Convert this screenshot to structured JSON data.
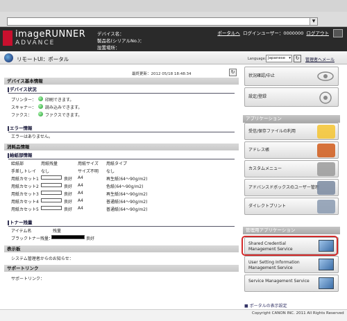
{
  "chrome": {},
  "header": {
    "logo_line1": "imageRUNNER",
    "logo_line2": "ADVANCE",
    "device_name": "デバイス名：",
    "serial": "製品名(シリアルNo.)：",
    "location": "設置場所：",
    "portal_link": "ポータルへ",
    "login_user": "ログインユーザー：0000000",
    "logout": "ログアウト"
  },
  "nav": {
    "title": "リモートUI：ポータル",
    "language_label": "Language:",
    "language_value": "Japanese",
    "manager_link": "管理者へメール"
  },
  "main": {
    "last_updated": "最終更新：2012 05/18 18:48:34",
    "device_info_header": "デバイス基本情報",
    "device_status_title": "デバイス状況",
    "device_status": [
      {
        "label": "プリンター：",
        "value": "印刷できます。"
      },
      {
        "label": "スキャナー：",
        "value": "読み込みできます。"
      },
      {
        "label": "ファクス：",
        "value": "ファクスできます。"
      }
    ],
    "error_title": "エラー情報",
    "error_text": "エラーはありません。",
    "consumables_header": "消耗品情報",
    "paper_title": "給紙部情報",
    "paper_columns": [
      "給紙部",
      "用紙残量",
      "用紙サイズ",
      "用紙タイプ"
    ],
    "paper_rows": [
      {
        "source": "手差しトレイ",
        "level": "なし",
        "size": "サイズ不明",
        "type": "なし",
        "bar": false
      },
      {
        "source": "用紙カセット1",
        "level": "良好",
        "size": "A4",
        "type": "再生紙(64〜90g/m2)",
        "bar": true
      },
      {
        "source": "用紙カセット2",
        "level": "良好",
        "size": "A4",
        "type": "色紙(64〜90g/m2)",
        "bar": true
      },
      {
        "source": "用紙カセット3",
        "level": "良好",
        "size": "A4",
        "type": "再生紙(64〜90g/m2)",
        "bar": true
      },
      {
        "source": "用紙カセット4",
        "level": "良好",
        "size": "A4",
        "type": "普通紙(64〜90g/m2)",
        "bar": true
      },
      {
        "source": "用紙カセット5",
        "level": "良好",
        "size": "A4",
        "type": "普通紙(64〜90g/m2)",
        "bar": true
      }
    ],
    "toner_title": "トナー残量",
    "toner_columns": [
      "アイテム名",
      "残量"
    ],
    "toner_row": {
      "name": "ブラックトナー残量：",
      "status": "良好"
    },
    "display_header": "表示板",
    "display_text": "システム管理者からのお知らせ：",
    "support_header": "サポートリンク",
    "support_text": "サポートリンク："
  },
  "sidebar": {
    "status_button": "状況確認/中止",
    "settings_button": "設定/登録",
    "applications_header": "アプリケーション",
    "apps": [
      "受信/保存ファイルの利用",
      "アドレス帳",
      "カスタムメニュー",
      "アドバンスドボックスのユーザー管理",
      "ダイレクトプリント"
    ],
    "admin_header": "管理用アプリケーション",
    "admin_apps": [
      "Shared Credential Management Service",
      "User Setting Information Management Service",
      "Service Management Service"
    ],
    "portal_display_link": "ポータルの表示設定"
  },
  "footer": {
    "copyright": "Copyright CANON INC. 2011 All Rights Reserved"
  },
  "colors": {
    "header_bg": "#2a2a2a",
    "logo_red": "#c8102e",
    "highlight": "#d42a2a",
    "status_green": "#1a9a2a"
  }
}
